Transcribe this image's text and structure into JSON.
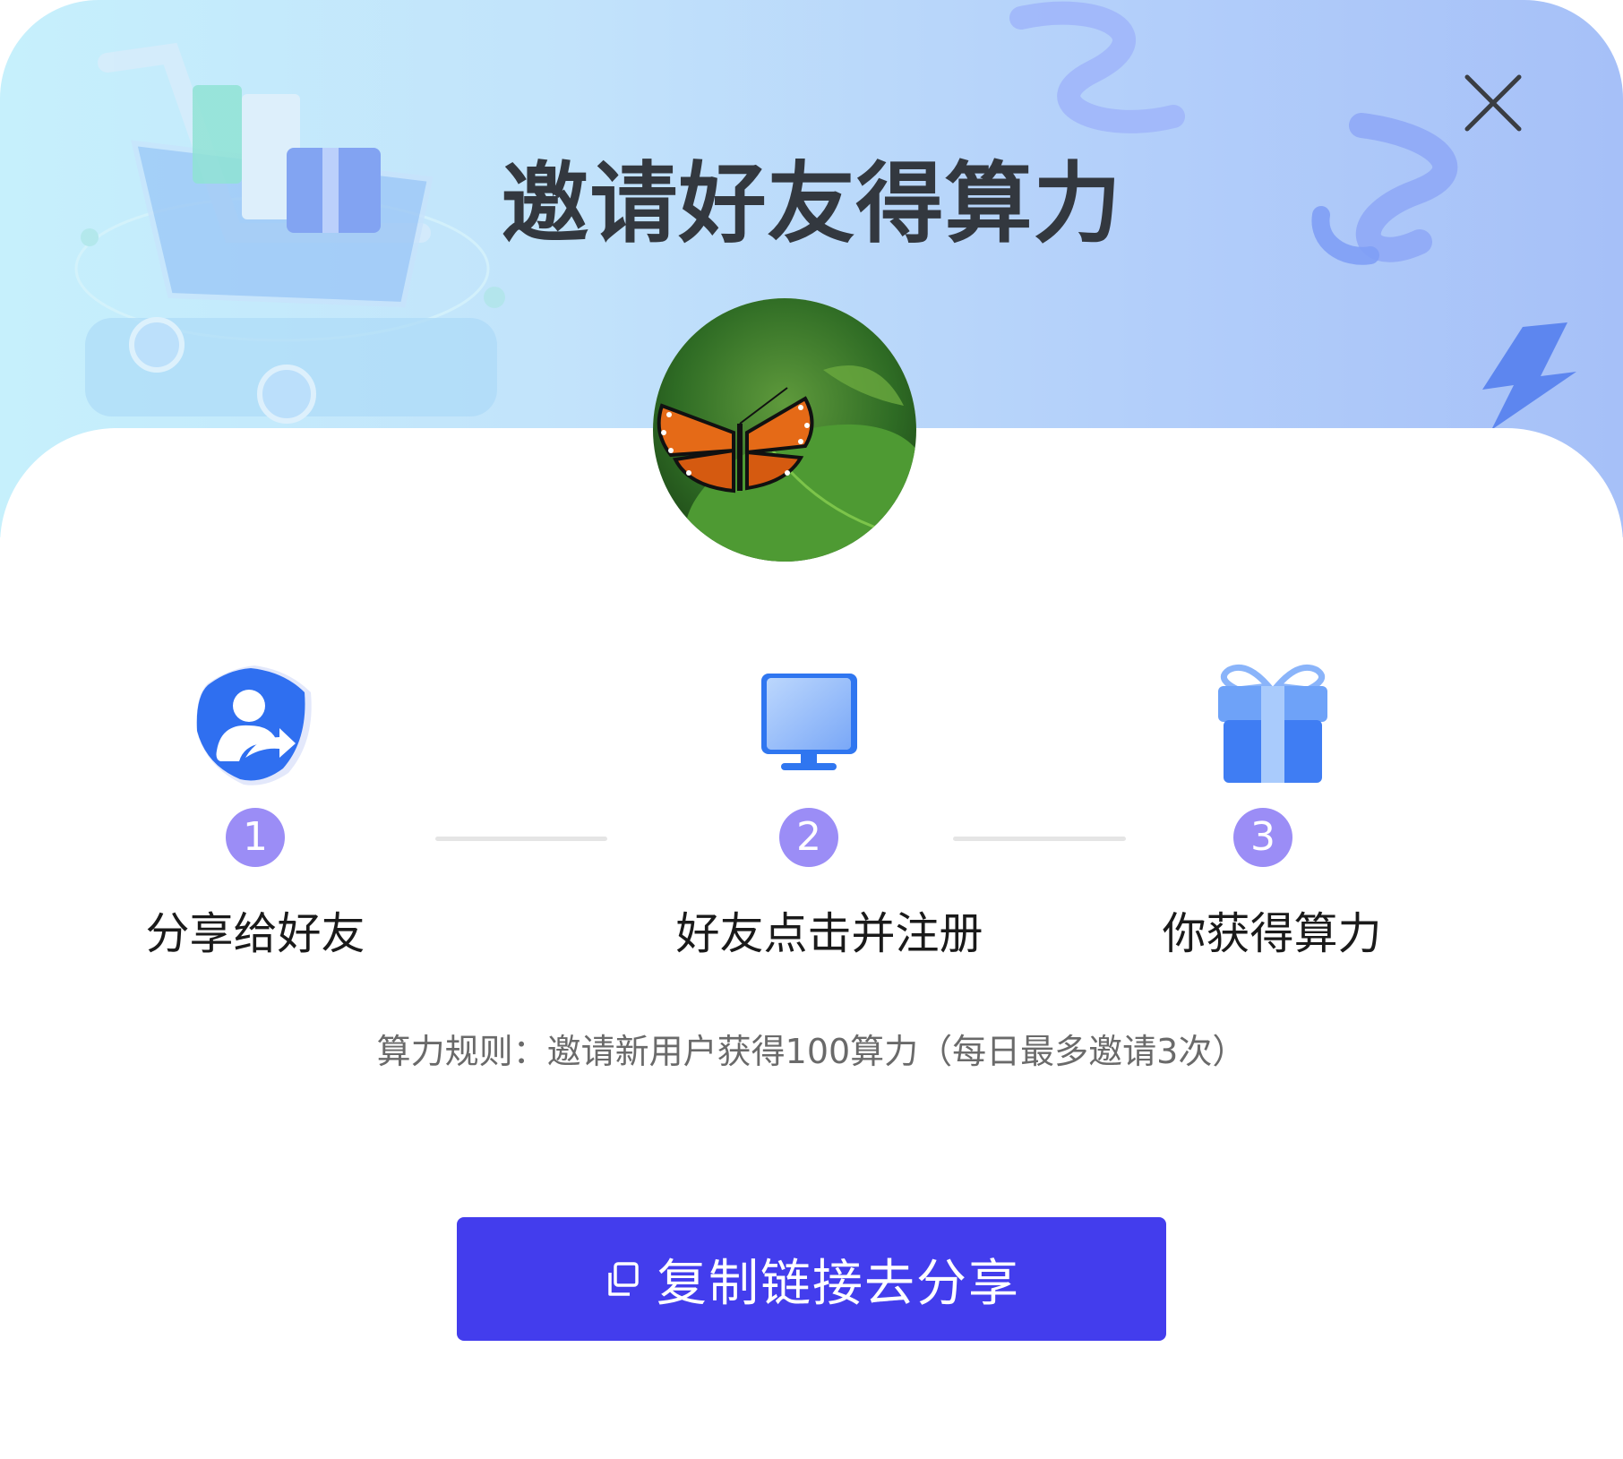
{
  "modal": {
    "title": "邀请好友得算力",
    "close_icon": "close-icon"
  },
  "avatar": {
    "description_icon": "butterfly-avatar"
  },
  "steps": [
    {
      "number": "1",
      "label": "分享给好友",
      "icon": "share-user-icon"
    },
    {
      "number": "2",
      "label": "好友点击并注册",
      "icon": "monitor-icon"
    },
    {
      "number": "3",
      "label": "你获得算力",
      "icon": "gift-icon"
    }
  ],
  "rule_text": "算力规则：邀请新用户获得100算力（每日最多邀请3次）",
  "share_button": {
    "label": "复制链接去分享",
    "icon": "copy-icon"
  },
  "colors": {
    "accent": "#433ded",
    "step_badge": "#9b8df6",
    "title": "#33383f"
  }
}
